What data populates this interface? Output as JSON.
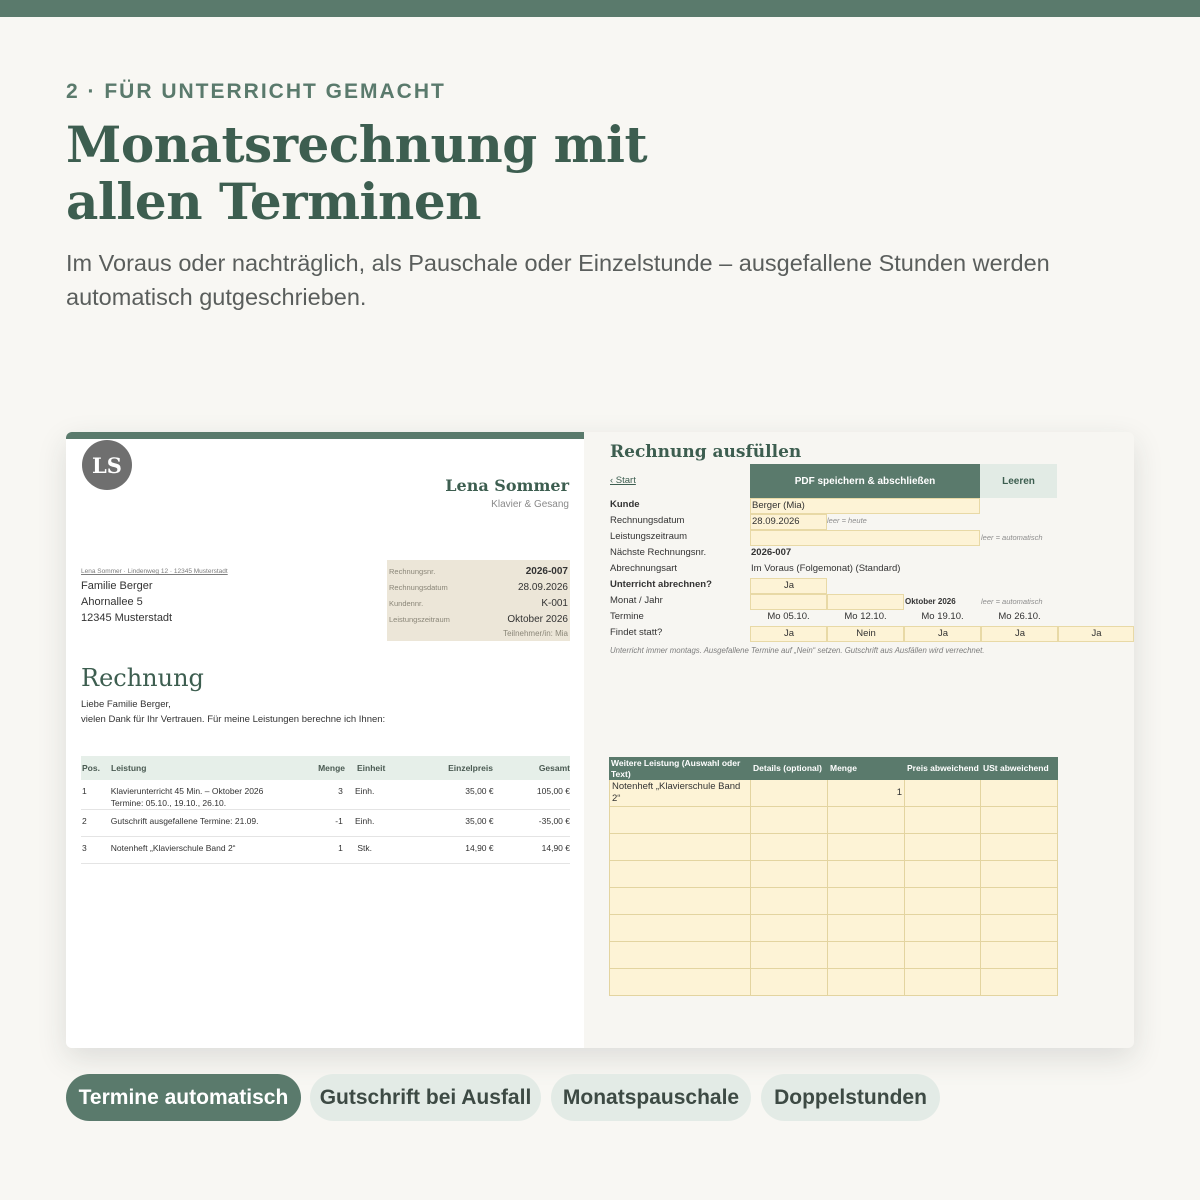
{
  "eyebrow": "2 · FÜR UNTERRICHT GEMACHT",
  "headline_line1": "Monatsrechnung mit",
  "headline_line2": "allen Terminen",
  "subline": "Im Voraus oder nachträglich, als Pauschale oder Einzelstunde – ausgefallene Stunden werden automatisch gutgeschrieben.",
  "colors": {
    "accent": "#5a7a6c",
    "input_fill": "#fdf3d6",
    "meta_fill": "#ece6d8",
    "background": "#f8f7f3"
  },
  "invoice": {
    "logo": "LS",
    "business_name": "Lena Sommer",
    "business_sub": "Klavier & Gesang",
    "sender_line": "Lena Sommer · Lindenweg 12 · 12345 Musterstadt",
    "recipient": [
      "Familie Berger",
      "Ahornallee 5",
      "12345 Musterstadt"
    ],
    "meta": [
      {
        "label": "Rechnungsnr.",
        "value": "2026-007"
      },
      {
        "label": "Rechnungsdatum",
        "value": "28.09.2026"
      },
      {
        "label": "Kundennr.",
        "value": "K-001"
      },
      {
        "label": "Leistungszeitraum",
        "value": "Oktober 2026"
      }
    ],
    "participant": "Teilnehmer/in: Mia",
    "title": "Rechnung",
    "greeting": "Liebe Familie Berger,",
    "intro": "vielen Dank für Ihr Vertrauen. Für meine Leistungen berechne ich Ihnen:",
    "columns": {
      "pos": "Pos.",
      "desc": "Leistung",
      "qty": "Menge",
      "unit": "Einheit",
      "price": "Einzelpreis",
      "total": "Gesamt"
    },
    "rows": [
      {
        "pos": "1",
        "desc": "Klavierunterricht 45 Min. – Oktober 2026",
        "desc2": "Termine: 05.10., 19.10., 26.10.",
        "qty": "3",
        "unit": "Einh.",
        "price": "35,00 €",
        "total": "105,00 €"
      },
      {
        "pos": "2",
        "desc": "Gutschrift ausgefallene Termine: 21.09.",
        "desc2": "",
        "qty": "-1",
        "unit": "Einh.",
        "price": "35,00 €",
        "total": "-35,00 €"
      },
      {
        "pos": "3",
        "desc": "Notenheft „Klavierschule Band 2“",
        "desc2": "",
        "qty": "1",
        "unit": "Stk.",
        "price": "14,90 €",
        "total": "14,90 €"
      }
    ]
  },
  "form": {
    "title": "Rechnung ausfüllen",
    "back_link": "‹ Start",
    "pdf_button": "PDF speichern & abschließen",
    "clear_button": "Leeren",
    "labels": {
      "kunde": "Kunde",
      "rechnungsdatum": "Rechnungsdatum",
      "leistungszeitraum": "Leistungszeitraum",
      "naechste": "Nächste Rechnungsnr.",
      "abrechnungsart": "Abrechnungsart",
      "unterricht": "Unterricht abrechnen?",
      "monat_jahr": "Monat / Jahr",
      "termine": "Termine",
      "findet_statt": "Findet statt?"
    },
    "values": {
      "kunde": "Berger (Mia)",
      "rechnungsdatum": "28.09.2026",
      "leistungszeitraum": "",
      "naechste": "2026-007",
      "abrechnungsart": "Im Voraus (Folgemonat)  (Standard)",
      "unterricht": "Ja",
      "monat_jahr_result": "Oktober 2026"
    },
    "hints": {
      "heute": "leer = heute",
      "auto1": "leer = automatisch",
      "auto2": "leer = automatisch"
    },
    "termine": [
      "Mo 05.10.",
      "Mo 12.10.",
      "Mo 19.10.",
      "Mo 26.10."
    ],
    "findet_statt": [
      "Ja",
      "Nein",
      "Ja",
      "Ja",
      "Ja"
    ],
    "note": "Unterricht immer montags. Ausgefallene Termine auf „Nein“ setzen. Gutschrift aus Ausfällen wird verrechnet.",
    "extra_columns": [
      "Weitere Leistung (Auswahl oder Text)",
      "Details (optional)",
      "Menge",
      "Preis abweichend",
      "USt abweichend"
    ],
    "extra_rows": [
      [
        "Notenheft „Klavierschule Band 2“",
        "",
        "1",
        "",
        ""
      ]
    ]
  },
  "tags": [
    {
      "label": "Termine automatisch",
      "active": true
    },
    {
      "label": "Gutschrift bei Ausfall",
      "active": false
    },
    {
      "label": "Monatspauschale",
      "active": false
    },
    {
      "label": "Doppelstunden",
      "active": false
    }
  ]
}
